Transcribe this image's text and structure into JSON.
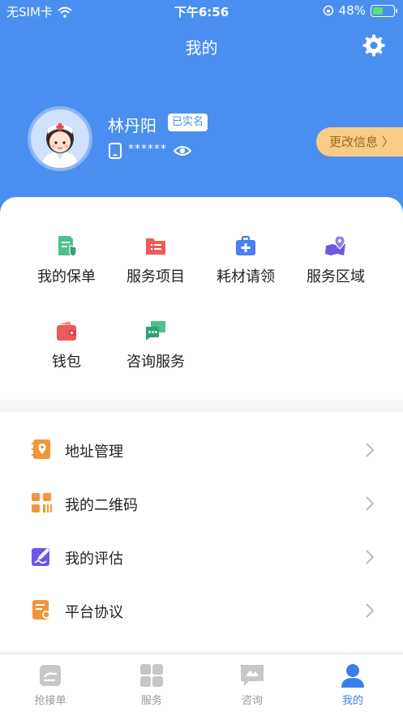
{
  "status_bar": {
    "carrier": "无SIM卡",
    "time": "下午6:56",
    "battery": "48%"
  },
  "header": {
    "title": "我的"
  },
  "profile": {
    "name": "林丹阳",
    "verified_badge": "已实名",
    "phone_masked": "******",
    "edit_label": "更改信息 〉"
  },
  "grid": [
    {
      "label": "我的保单",
      "icon": "policy-icon",
      "color": "#4cc38a"
    },
    {
      "label": "服务项目",
      "icon": "service-items-icon",
      "color": "#ef5a5a"
    },
    {
      "label": "耗材请领",
      "icon": "medical-kit-icon",
      "color": "#4a7ff0"
    },
    {
      "label": "服务区域",
      "icon": "map-area-icon",
      "color": "#6b58e8"
    },
    {
      "label": "钱包",
      "icon": "wallet-icon",
      "color": "#ef5a5a"
    },
    {
      "label": "咨询服务",
      "icon": "consult-icon",
      "color": "#4cc38a"
    }
  ],
  "list": [
    {
      "label": "地址管理",
      "icon": "address-book-icon"
    },
    {
      "label": "我的二维码",
      "icon": "qr-code-icon"
    },
    {
      "label": "我的评估",
      "icon": "evaluation-icon"
    },
    {
      "label": "平台协议",
      "icon": "agreement-icon"
    }
  ],
  "tabbar": [
    {
      "label": "抢接单",
      "icon": "grab-order-icon",
      "active": false
    },
    {
      "label": "服务",
      "icon": "services-grid-icon",
      "active": false
    },
    {
      "label": "咨询",
      "icon": "chat-icon",
      "active": false
    },
    {
      "label": "我的",
      "icon": "person-icon",
      "active": true
    }
  ],
  "colors": {
    "primary": "#4a8ff0",
    "accent_orange": "#f0953a",
    "gold_button": "#f7cc87"
  }
}
